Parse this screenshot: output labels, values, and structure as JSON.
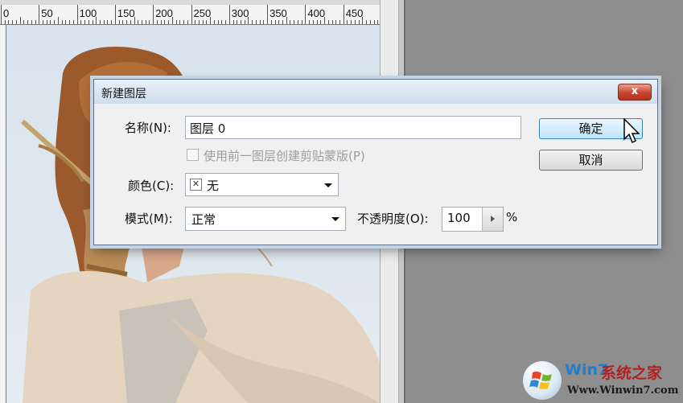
{
  "ruler": {
    "marks": [
      "0",
      "50",
      "100",
      "150",
      "200",
      "250",
      "300",
      "350",
      "400",
      "450"
    ]
  },
  "dialog": {
    "title": "新建图层",
    "close_label": "x",
    "name_label": "名称(N):",
    "name_value": "图层 0",
    "clip_checkbox_label": "使用前一图层创建剪贴蒙版(P)",
    "clip_checked": false,
    "color_label": "颜色(C):",
    "color_value": "无",
    "color_icon": "x-swatch-icon",
    "mode_label": "模式(M):",
    "mode_value": "正常",
    "opacity_label": "不透明度(O):",
    "opacity_value": "100",
    "opacity_unit": "%",
    "ok_label": "确定",
    "cancel_label": "取消"
  },
  "watermark": {
    "brand_latin": "Win7",
    "brand_cn": "系统之家",
    "url": "Www.Winwin7.com"
  },
  "colors": {
    "dialog_border": "#5a6f88",
    "close_red": "#c8442e",
    "ok_button_blue": "#bee6fd",
    "workspace_gray": "#8e8e8e"
  }
}
